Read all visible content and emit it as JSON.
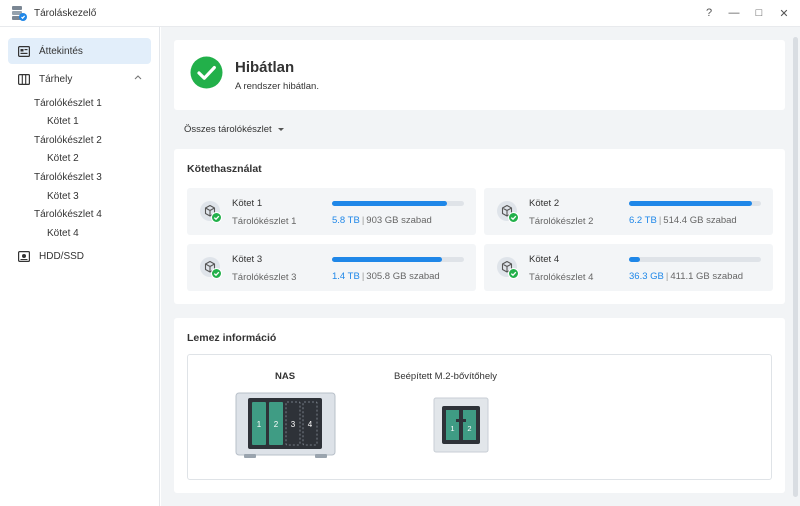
{
  "window": {
    "title": "Tároláskezelő",
    "help": "?",
    "minimize": "—",
    "maximize": "□",
    "close": "✕"
  },
  "sidebar": {
    "overview": "Áttekintés",
    "storage": "Tárhely",
    "pools": [
      {
        "label": "Tárolókészlet 1",
        "volume": "Kötet 1"
      },
      {
        "label": "Tárolókészlet 2",
        "volume": "Kötet 2"
      },
      {
        "label": "Tárolókészlet 3",
        "volume": "Kötet 3"
      },
      {
        "label": "Tárolókészlet 4",
        "volume": "Kötet 4"
      }
    ],
    "hdd": "HDD/SSD"
  },
  "status": {
    "title": "Hibátlan",
    "description": "A rendszer hibátlan."
  },
  "filter": {
    "label": "Összes tárolókészlet"
  },
  "usage": {
    "title": "Kötethasználat",
    "volumes": [
      {
        "name": "Kötet 1",
        "pool": "Tárolókészlet 1",
        "used": "5.8 TB",
        "free": "903 GB szabad",
        "fraction": 0.87
      },
      {
        "name": "Kötet 2",
        "pool": "Tárolókészlet 2",
        "used": "6.2 TB",
        "free": "514.4 GB szabad",
        "fraction": 0.93
      },
      {
        "name": "Kötet 3",
        "pool": "Tárolókészlet 3",
        "used": "1.4 TB",
        "free": "305.8 GB szabad",
        "fraction": 0.83
      },
      {
        "name": "Kötet 4",
        "pool": "Tárolókészlet 4",
        "used": "36.3 GB",
        "free": "411.1 GB szabad",
        "fraction": 0.08
      }
    ]
  },
  "disks": {
    "title": "Lemez információ",
    "nas_label": "NAS",
    "m2_label": "Beépített M.2-bővítőhely",
    "nas_slots": [
      "1",
      "2",
      "3",
      "4"
    ],
    "m2_slots": [
      "1",
      "2"
    ]
  },
  "colors": {
    "accent": "#1f87e8",
    "success": "#22b04a",
    "slot_filled": "#3f9c84",
    "active_nav": "#e2eefa"
  }
}
